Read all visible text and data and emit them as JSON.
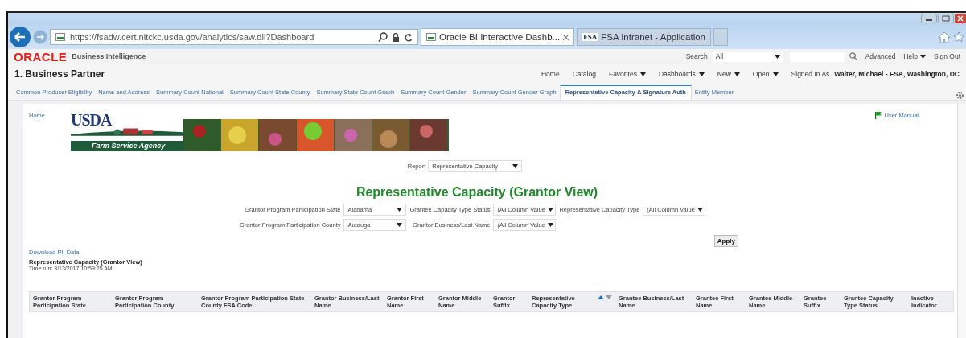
{
  "browser": {
    "url": "https://fsadw.cert.nitckc.usda.gov/analytics/saw.dll?Dashboard",
    "tabs": [
      {
        "title": "Oracle BI Interactive Dashb...",
        "selected": true,
        "kind": "page"
      },
      {
        "title": "FSA Intranet - Application",
        "selected": false,
        "kind": "fsa",
        "badge": "FSA"
      }
    ]
  },
  "header": {
    "brand": "ORACLE",
    "product": "Business Intelligence",
    "search_label": "Search",
    "search_scope": "All",
    "links": [
      "Advanced",
      "Help",
      "Sign Out"
    ]
  },
  "dashboard": {
    "title": "1. Business Partner",
    "nav": [
      {
        "label": "Home",
        "menu": false
      },
      {
        "label": "Catalog",
        "menu": false
      },
      {
        "label": "Favorites",
        "menu": true
      },
      {
        "label": "Dashboards",
        "menu": true
      },
      {
        "label": "New",
        "menu": true
      },
      {
        "label": "Open",
        "menu": true
      }
    ],
    "signed_in_label": "Signed In As",
    "user": "Walter, Michael - FSA, Washington, DC"
  },
  "page_tabs": [
    {
      "label": "Common Producer Eligibility",
      "selected": false
    },
    {
      "label": "Name and Address",
      "selected": false
    },
    {
      "label": "Summary Count National",
      "selected": false
    },
    {
      "label": "Summary Count State County",
      "selected": false
    },
    {
      "label": "Summary State Count Graph",
      "selected": false
    },
    {
      "label": "Summary Count Gender",
      "selected": false
    },
    {
      "label": "Summary Count Gender Graph",
      "selected": false
    },
    {
      "label": "Representative Capacity & Signature Auth",
      "selected": true
    },
    {
      "label": "Entity Member",
      "selected": false
    }
  ],
  "content": {
    "home_link": "Home",
    "banner": {
      "logo": "USDA",
      "agency": "Farm Service Agency"
    },
    "user_manual": "User Manual",
    "report": {
      "label": "Report",
      "value": "Representative Capacity"
    },
    "title": "Representative Capacity (Grantor View)",
    "prompts": [
      [
        {
          "label": "Grantor Program Participation State",
          "value": "Alabama"
        },
        {
          "label": "Grantee Capacity Type Status",
          "value": "(All Column Value"
        },
        {
          "label": "Representative Capacity Type",
          "value": "(All Column Value"
        }
      ],
      [
        {
          "label": "Grantor Program Participation County",
          "value": "Autauga"
        },
        {
          "label": "Grantor Business/Last Name",
          "value": "(All Column Value"
        }
      ]
    ],
    "apply": "Apply",
    "download_link": "Download PII Data",
    "view_title": "Representative Capacity (Grantor View)",
    "time_run": "Time run: 3/13/2017 10:59:25 AM",
    "table": {
      "columns": [
        {
          "label": "Grantor Program Participation State",
          "sortable": false
        },
        {
          "label": "Grantor Program Participation County",
          "sortable": false
        },
        {
          "label": "Grantor Program Participation State County FSA Code",
          "sortable": false
        },
        {
          "label": "Grantor Business/Last Name",
          "sortable": false
        },
        {
          "label": "Grantor First Name",
          "sortable": false
        },
        {
          "label": "Grantor Middle Name",
          "sortable": false
        },
        {
          "label": "Grantor Suffix",
          "sortable": false
        },
        {
          "label": "Representative Capacity Type",
          "sortable": true
        },
        {
          "label": "Grantee Business/Last Name",
          "sortable": false
        },
        {
          "label": "Grantee First Name",
          "sortable": false
        },
        {
          "label": "Grantee Middle Name",
          "sortable": false
        },
        {
          "label": "Grantee Suffix",
          "sortable": false
        },
        {
          "label": "Grantee Capacity Type Status",
          "sortable": false
        },
        {
          "label": "Inactive Indicator",
          "sortable": false
        }
      ]
    }
  }
}
